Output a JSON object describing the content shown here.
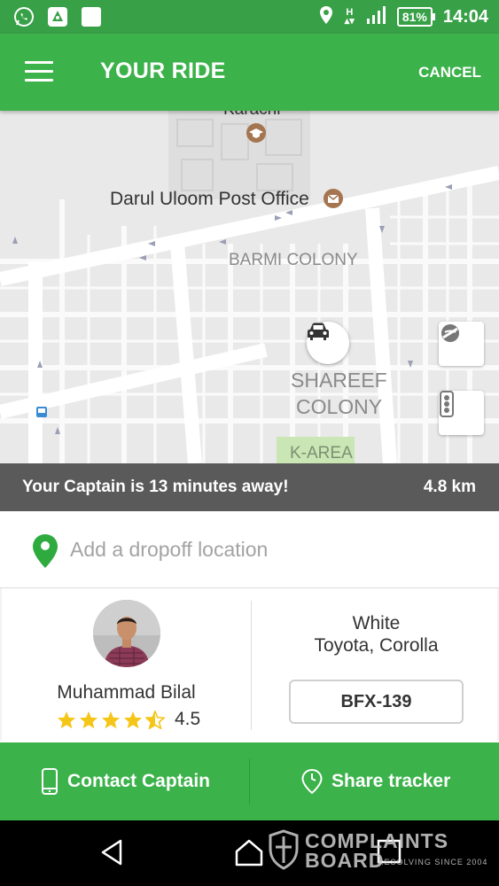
{
  "status_bar": {
    "battery": "81%",
    "time": "14:04",
    "network": "H"
  },
  "app_bar": {
    "title": "YOUR RIDE",
    "cancel_label": "CANCEL"
  },
  "map": {
    "labels": {
      "top": "Karachi",
      "post_office": "Darul Uloom Post Office",
      "barmi": "BARMI COLONY",
      "shareef_1": "SHAREEF",
      "shareef_2": "COLONY",
      "karea": "K-AREA"
    }
  },
  "eta": {
    "message": "Your Captain is 13 minutes away!",
    "distance": "4.8 km"
  },
  "dropoff": {
    "placeholder": "Add a dropoff location"
  },
  "captain": {
    "name": "Muhammad Bilal",
    "rating": "4.5",
    "rating_value": 4.5,
    "rating_max": 5
  },
  "vehicle": {
    "color": "White",
    "model": "Toyota, Corolla",
    "plate": "BFX-139"
  },
  "actions": {
    "contact_label": "Contact Captain",
    "share_label": "Share tracker"
  },
  "watermark": {
    "line1": "COMPLAINTS",
    "line2": "BOARD",
    "line3": "RESOLVING SINCE 2004"
  },
  "colors": {
    "brand_green": "#3bb24a",
    "status_green": "#38a148",
    "eta_gray": "#5a5a5a",
    "star_yellow": "#f5c518",
    "pin_green": "#2eaa3f"
  }
}
